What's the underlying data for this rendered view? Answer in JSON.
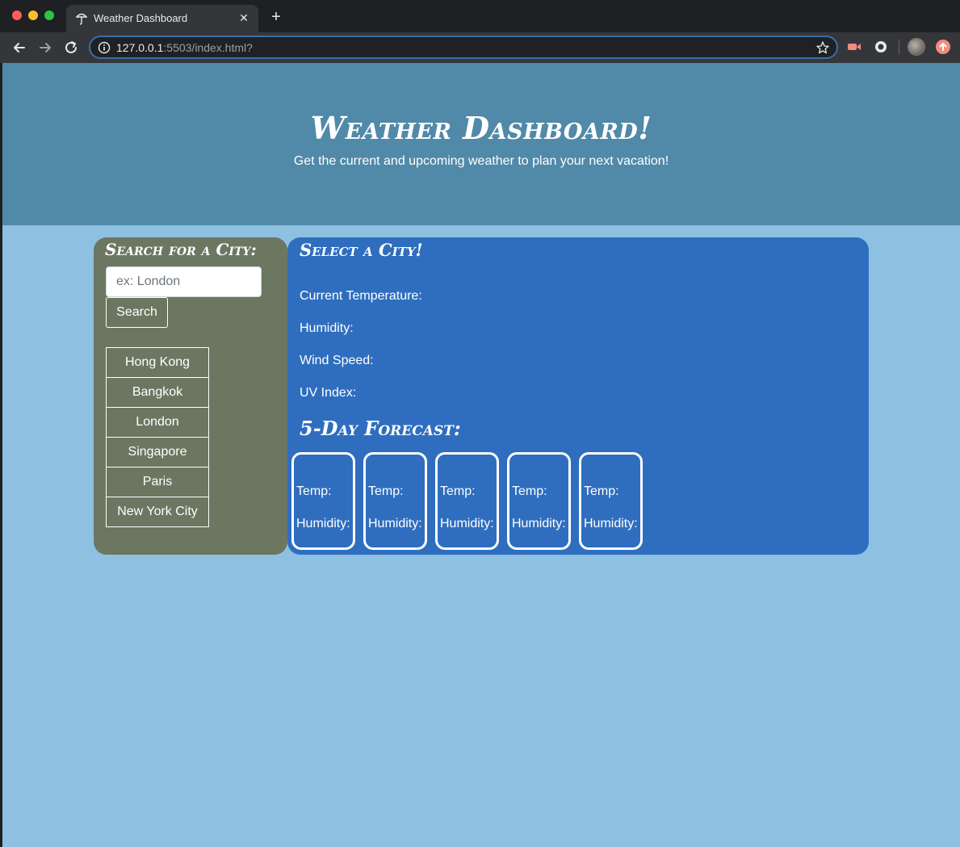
{
  "browser": {
    "tab_title": "Weather Dashboard",
    "url_host": "127.0.0.1",
    "url_path": ":5503/index.html?"
  },
  "header": {
    "title": "Weather Dashboard!",
    "subtitle": "Get the current and upcoming weather to plan your next vacation!"
  },
  "search": {
    "heading": "Search for a City:",
    "placeholder": "ex: London",
    "button_label": "Search",
    "cities": [
      "Hong Kong",
      "Bangkok",
      "London",
      "Singapore",
      "Paris",
      "New York City"
    ]
  },
  "current": {
    "heading": "Select a City!",
    "temperature_label": "Current Temperature:",
    "humidity_label": "Humidity:",
    "wind_label": "Wind Speed:",
    "uv_label": "UV Index:"
  },
  "forecast": {
    "heading": "5-Day Forecast:",
    "cards": [
      {
        "temp_label": "Temp:",
        "humidity_label": "Humidity:"
      },
      {
        "temp_label": "Temp:",
        "humidity_label": "Humidity:"
      },
      {
        "temp_label": "Temp:",
        "humidity_label": "Humidity:"
      },
      {
        "temp_label": "Temp:",
        "humidity_label": "Humidity:"
      },
      {
        "temp_label": "Temp:",
        "humidity_label": "Humidity:"
      }
    ]
  },
  "colors": {
    "header_bg": "#5189a8",
    "page_bg": "#8ec0e2",
    "search_panel_bg": "#6b7761",
    "weather_panel_bg": "#2f6ebf"
  }
}
